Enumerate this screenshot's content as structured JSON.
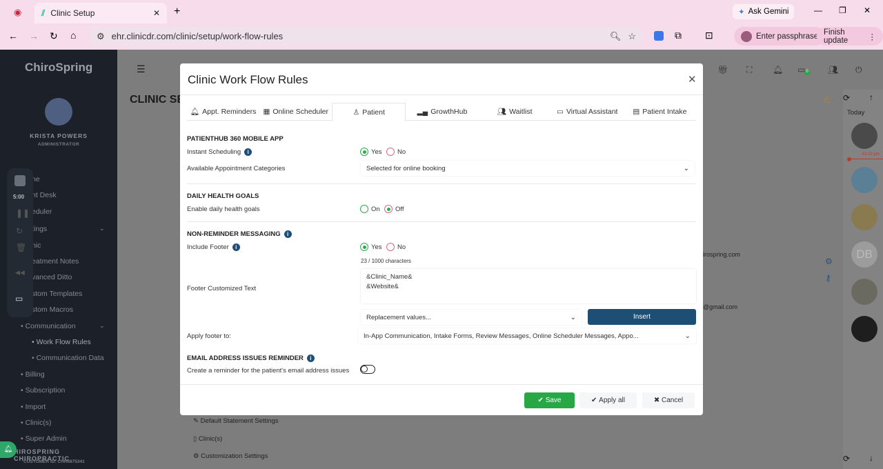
{
  "browser": {
    "tab_title": "Clinic Setup",
    "url": "ehr.clinicdr.com/clinic/setup/work-flow-rules",
    "ask_gemini": "Ask Gemini",
    "enter_passphrase": "Enter passphrase",
    "finish_update": "Finish update"
  },
  "sidebar": {
    "brand": "ChiroSpring",
    "user_name": "KRISTA POWERS",
    "user_role": "ADMINISTRATOR",
    "recorder_time": "5:00",
    "items": [
      {
        "label": "ne"
      },
      {
        "label": "nt Desk"
      },
      {
        "label": "eduler"
      },
      {
        "label": "tings"
      },
      {
        "label": "nic"
      },
      {
        "label": "eatment Notes"
      },
      {
        "label": "vanced Ditto"
      },
      {
        "label": "stom Templates"
      },
      {
        "label": "stom Macros"
      },
      {
        "label": "• Communication"
      },
      {
        "label": "• Work Flow Rules"
      },
      {
        "label": "• Communication Data"
      },
      {
        "label": "• Billing"
      },
      {
        "label": "• Subscription"
      },
      {
        "label": "• Import"
      },
      {
        "label": "• Clinic(s)"
      },
      {
        "label": "• Super Admin"
      }
    ],
    "clinic_name": "HIROSPRING CHIROPRACTIC",
    "customer_id": "CUSTOMER ID: CHR6875341"
  },
  "main": {
    "page_title": "CLINIC SE",
    "email1": "irospring.com",
    "email2": "@gmail.com",
    "links": [
      "Default Statement Settings",
      "Clinic(s)",
      "Customization Settings"
    ],
    "message_badge": "0"
  },
  "right_panel": {
    "today": "Today",
    "time_marker": "01:02 pm",
    "initials": "DB"
  },
  "modal": {
    "title": "Clinic Work Flow Rules",
    "tabs": [
      {
        "label": "Appt. Reminders",
        "icon": "bell"
      },
      {
        "label": "Online Scheduler",
        "icon": "calendar"
      },
      {
        "label": "Patient",
        "icon": "user"
      },
      {
        "label": "GrowthHub",
        "icon": "bar-chart"
      },
      {
        "label": "Waitlist",
        "icon": "users"
      },
      {
        "label": "Virtual Assistant",
        "icon": "chat"
      },
      {
        "label": "Patient Intake",
        "icon": "document"
      }
    ],
    "active_tab": "Patient",
    "patienthub": {
      "heading": "PATIENTHUB 360 MOBILE APP",
      "instant_label": "Instant Scheduling",
      "instant_value": "Yes",
      "yes": "Yes",
      "no": "No",
      "categories_label": "Available Appointment Categories",
      "categories_value": "Selected for online booking"
    },
    "health": {
      "heading": "DAILY HEALTH GOALS",
      "label": "Enable daily health goals",
      "on": "On",
      "off": "Off",
      "value": "Off"
    },
    "messaging": {
      "heading": "NON-REMINDER MESSAGING",
      "footer_label": "Include Footer",
      "footer_value": "Yes",
      "yes": "Yes",
      "no": "No",
      "char_count": "23 / 1000 characters",
      "text_label": "Footer Customized Text",
      "text_value": "&Clinic_Name&\n&Website&",
      "replacement_placeholder": "Replacement values...",
      "insert": "Insert",
      "apply_label": "Apply footer to:",
      "apply_value": "In-App Communication, Intake Forms, Review Messages, Online Scheduler Messages, Appo..."
    },
    "email": {
      "heading": "EMAIL ADDRESS ISSUES REMINDER",
      "label": "Create a reminder for the patient's email address issues",
      "toggle_on": false
    },
    "save": "Save",
    "apply_all": "Apply all",
    "cancel": "Cancel"
  },
  "colors": {
    "save": "#28a745",
    "insert": "#1d4e74",
    "sidebar": "#1b2029",
    "chrome": "#f7dcec"
  }
}
